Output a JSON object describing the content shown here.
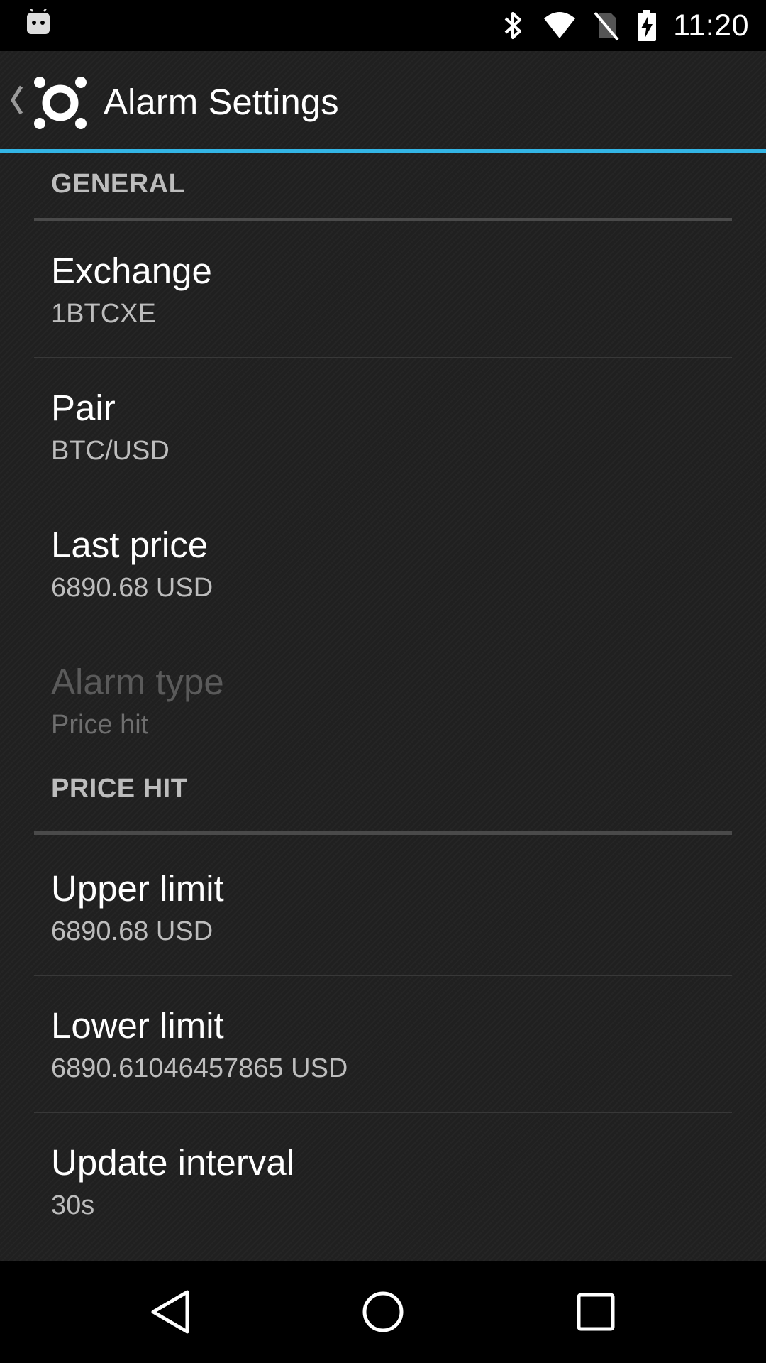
{
  "status_bar": {
    "time": "11:20",
    "icons": [
      "android-icon",
      "bluetooth-icon",
      "wifi-icon",
      "no-sim-icon",
      "battery-charging-icon"
    ]
  },
  "action_bar": {
    "title": "Alarm Settings",
    "icons": [
      "back-chevron-icon",
      "app-logo-icon"
    ]
  },
  "accent_color": "#33b5e5",
  "categories": {
    "general": {
      "label": "GENERAL",
      "items": [
        {
          "title": "Exchange",
          "summary": "1BTCXE"
        },
        {
          "title": "Pair",
          "summary": "BTC/USD"
        },
        {
          "title": "Last price",
          "summary": "6890.68 USD"
        },
        {
          "title": "Alarm type",
          "summary": "Price hit",
          "enabled": false
        }
      ]
    },
    "price_hit": {
      "label": "PRICE HIT",
      "items": [
        {
          "title": "Upper limit",
          "summary": "6890.68 USD"
        },
        {
          "title": "Lower limit",
          "summary": "6890.61046457865 USD"
        },
        {
          "title": "Update interval",
          "summary": "30s"
        }
      ]
    }
  },
  "nav_bar": {
    "icons": [
      "nav-back-icon",
      "nav-home-icon",
      "nav-recents-icon"
    ]
  }
}
